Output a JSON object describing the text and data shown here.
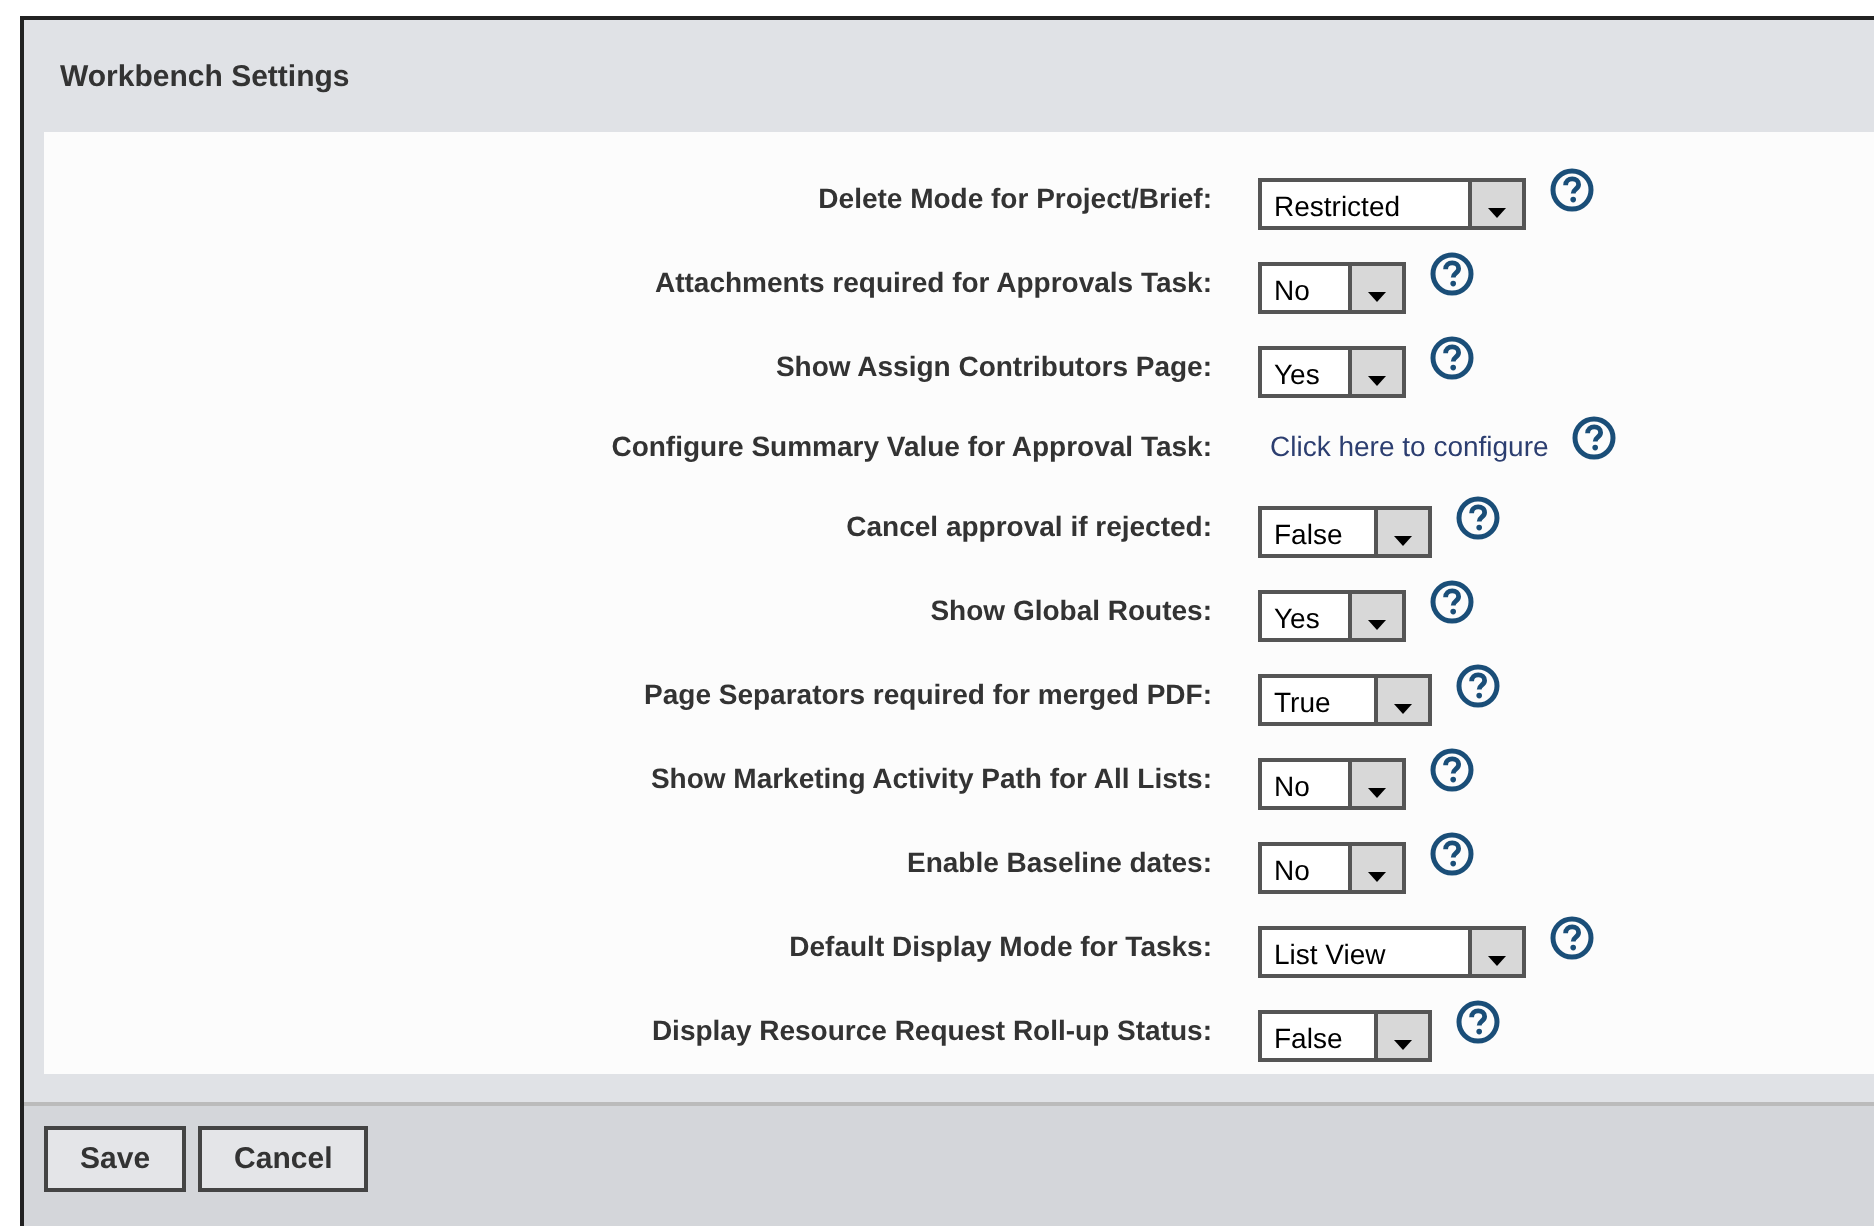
{
  "panel": {
    "title": "Workbench Settings"
  },
  "settings": [
    {
      "label": "Delete Mode for Project/Brief:",
      "kind": "select",
      "value": "Restricted"
    },
    {
      "label": "Attachments required for Approvals Task:",
      "kind": "select",
      "value": "No"
    },
    {
      "label": "Show Assign Contributors Page:",
      "kind": "select",
      "value": "Yes"
    },
    {
      "label": "Configure Summary Value for Approval Task:",
      "kind": "link",
      "value": "Click here to configure"
    },
    {
      "label": "Cancel approval if rejected:",
      "kind": "select",
      "value": "False"
    },
    {
      "label": "Show Global Routes:",
      "kind": "select",
      "value": "Yes"
    },
    {
      "label": "Page Separators required for merged PDF:",
      "kind": "select",
      "value": "True"
    },
    {
      "label": "Show Marketing Activity Path for All Lists:",
      "kind": "select",
      "value": "No"
    },
    {
      "label": "Enable Baseline dates:",
      "kind": "select",
      "value": "No"
    },
    {
      "label": "Default Display Mode for Tasks:",
      "kind": "select",
      "value": "List View"
    },
    {
      "label": "Display Resource Request Roll-up Status:",
      "kind": "select",
      "value": "False"
    }
  ],
  "buttons": [
    "Save",
    "Cancel"
  ]
}
